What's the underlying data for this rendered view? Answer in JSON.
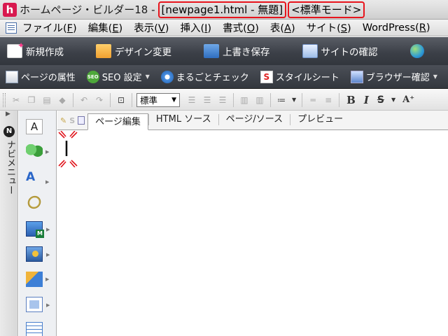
{
  "window": {
    "app_title": "ホームページ・ビルダー18 -",
    "document_label": "[newpage1.html - 無題]",
    "mode_label": "<標準モード>",
    "app_icon_letter": "h",
    "highlight_color": "#e8141c"
  },
  "menu": {
    "items": [
      {
        "label": "ファイル(",
        "key": "F",
        "end": ")"
      },
      {
        "label": "編集(",
        "key": "E",
        "end": ")"
      },
      {
        "label": "表示(",
        "key": "V",
        "end": ")"
      },
      {
        "label": "挿入(",
        "key": "I",
        "end": ")"
      },
      {
        "label": "書式(",
        "key": "O",
        "end": ")"
      },
      {
        "label": "表(",
        "key": "A",
        "end": ")"
      },
      {
        "label": "サイト(",
        "key": "S",
        "end": ")"
      },
      {
        "label": "WordPress(",
        "key": "R",
        "end": ")"
      }
    ]
  },
  "main_toolbar": {
    "new_label": "新規作成",
    "design_label": "デザイン変更",
    "save_label": "上書き保存",
    "site_check_label": "サイトの確認"
  },
  "sub_toolbar": {
    "page_attr_label": "ページの属性",
    "seo_label": "SEO 設定",
    "check_label": "まるごとチェック",
    "stylesheet_label": "スタイルシート",
    "browser_check_label": "ブラウザー確認",
    "seo_icon_text": "SEO",
    "stylesheet_icon_text": "S"
  },
  "format_toolbar": {
    "style_value": "標準",
    "bold": "B",
    "italic": "I",
    "strike": "S",
    "font_size": "A⁺"
  },
  "nav_panel": {
    "badge": "N",
    "label": "ナビメニュー"
  },
  "palette": {
    "text_tool": "A"
  },
  "editor_tabs": {
    "tabs": [
      {
        "label": "ページ編集",
        "active": true
      },
      {
        "label": "HTML ソース",
        "active": false
      },
      {
        "label": "ページ/ソース",
        "active": false
      },
      {
        "label": "プレビュー",
        "active": false
      }
    ],
    "small_icon_s": "S"
  },
  "colors": {
    "dark_toolbar": "#3c4048",
    "accent_red": "#e8141c",
    "app_icon_bg": "#d8194f"
  }
}
